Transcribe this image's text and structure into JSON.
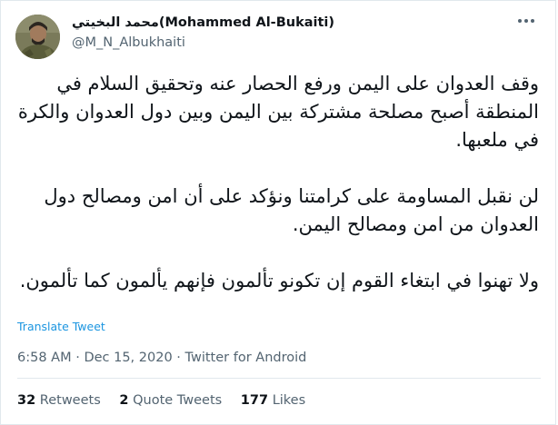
{
  "author": {
    "display_name": "محمد البخيتي(Mohammed Al-Bukaiti)",
    "handle": "@M_N_Albukhaiti"
  },
  "tweet": {
    "paragraphs": [
      "وقف العدوان على اليمن ورفع الحصار عنه وتحقيق السلام في المنطقة أصبح مصلحة مشتركة بين اليمن وبين دول العدوان والكرة في ملعبها.",
      "لن نقبل المساومة على كرامتنا ونؤكد على أن امن ومصالح دول العدوان من امن ومصالح اليمن.",
      "ولا تهنوا في ابتغاء القوم إن تكونو تألمون فإنهم يألمون كما تألمون."
    ],
    "translate_label": "Translate Tweet"
  },
  "meta": {
    "time": "6:58 AM",
    "separator": "·",
    "date": "Dec 15, 2020",
    "source": "Twitter for Android"
  },
  "stats": {
    "retweets_count": "32",
    "retweets_label": "Retweets",
    "quotes_count": "2",
    "quotes_label": "Quote Tweets",
    "likes_count": "177",
    "likes_label": "Likes"
  },
  "icons": {
    "more": "more-options-icon"
  },
  "colors": {
    "link": "#1b95e0",
    "secondary_text": "#536471",
    "divider": "#e1e8ed"
  }
}
